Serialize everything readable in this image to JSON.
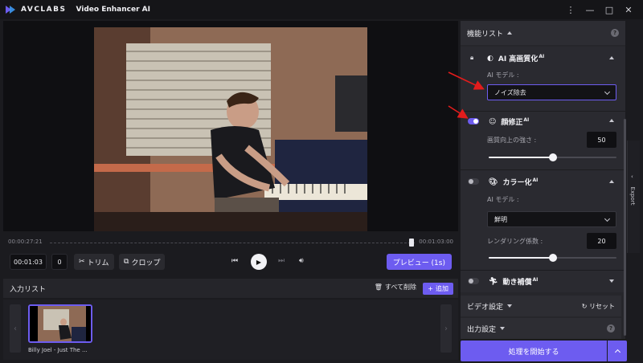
{
  "app": {
    "brand": "AVCLABS",
    "title": "Video Enhancer AI",
    "window_controls": [
      "⋮",
      "—",
      "□",
      "✕"
    ]
  },
  "player": {
    "time_start": "00:00:27:21",
    "time_end": "00:01:03:00",
    "current_time": "00:01:03",
    "frame": "0",
    "trim_label": "トリム",
    "crop_label": "クロップ",
    "preview_label": "プレビュー (1s)"
  },
  "input_list": {
    "title": "入力リスト",
    "delete_all": "すべて削除",
    "add": "追加",
    "items": [
      {
        "name": "Billy Joel - Just The ..."
      }
    ]
  },
  "features": {
    "header": "機能リスト",
    "help": "?",
    "ai_upscale": {
      "title": "AI 高画質化",
      "ai": "AI",
      "model_label": "AI モデル :",
      "model_value": "ノイズ除去"
    },
    "face": {
      "title": "顔修正",
      "ai": "AI",
      "enabled": true,
      "strength_label": "画質向上の強さ :",
      "strength_value": "50",
      "strength_fraction": 0.5
    },
    "colorize": {
      "title": "カラー化",
      "ai": "AI",
      "enabled": false,
      "model_label": "AI モデル :",
      "model_value": "鮮明",
      "render_label": "レンダリング係数 :",
      "render_value": "20",
      "render_fraction": 0.5
    },
    "motion": {
      "title": "動き補償",
      "ai": "AI",
      "enabled": false
    }
  },
  "video_settings": {
    "title": "ビデオ設定",
    "reset": "リセット"
  },
  "output_settings": {
    "title": "出力設定",
    "help": "?"
  },
  "start_button": "処理を開始する",
  "export_tab": "Export",
  "colors": {
    "accent": "#6d5cf0",
    "annotation_arrow": "#e21c1c"
  }
}
